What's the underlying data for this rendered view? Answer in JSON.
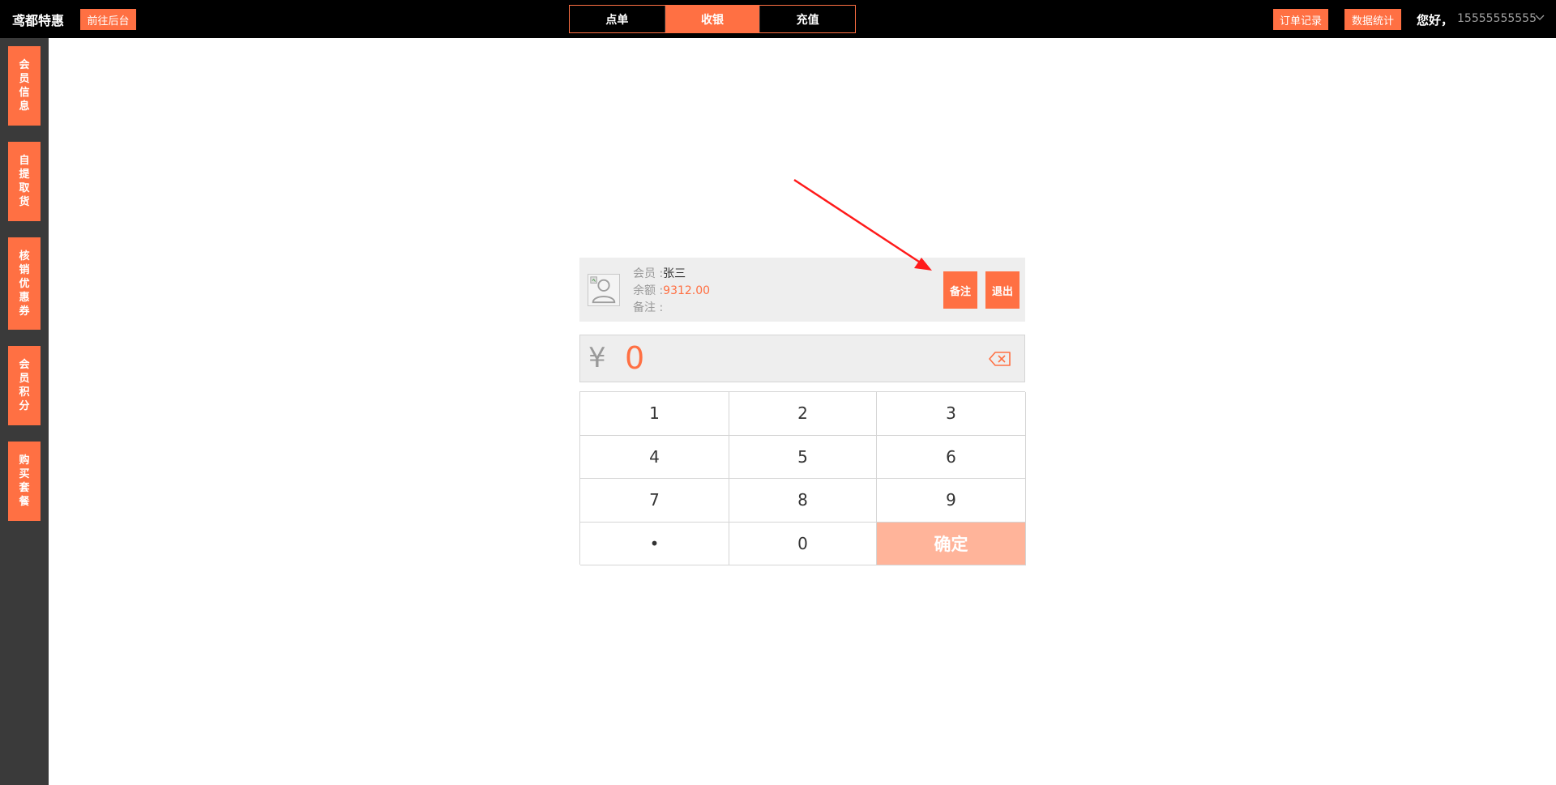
{
  "header": {
    "brand": "鸢都特惠",
    "backend_button": "前往后台",
    "tabs": [
      {
        "label": "点单",
        "active": false
      },
      {
        "label": "收银",
        "active": true
      },
      {
        "label": "充值",
        "active": false
      }
    ],
    "orders_button": "订单记录",
    "stats_button": "数据统计",
    "greeting": "您好，",
    "username": "15555555555"
  },
  "sidebar": {
    "items": [
      {
        "label": "会员信息"
      },
      {
        "label": "自提取货"
      },
      {
        "label": "核销优惠券"
      },
      {
        "label": "会员积分"
      },
      {
        "label": "购买套餐"
      }
    ]
  },
  "member": {
    "name_label": "会员 :",
    "name": "张三",
    "balance_label": "余额 :",
    "balance": "9312.00",
    "note_label": "备注 :",
    "note_value": "",
    "note_button": "备注",
    "logout_button": "退出"
  },
  "amount": {
    "currency": "¥",
    "value": "0"
  },
  "keypad": {
    "keys": [
      "1",
      "2",
      "3",
      "4",
      "5",
      "6",
      "7",
      "8",
      "9",
      "•",
      "0"
    ],
    "confirm": "确定"
  },
  "colors": {
    "accent": "#ff7043",
    "accent_light": "#ffb49a",
    "topbar": "#000000",
    "sidebar": "#3a3a3a",
    "panel": "#eeeeee",
    "annotation": "#ff1a1a"
  },
  "icons": {
    "avatar": "user-avatar-icon",
    "backspace": "backspace-icon",
    "user_menu": "chevron-down-icon"
  }
}
